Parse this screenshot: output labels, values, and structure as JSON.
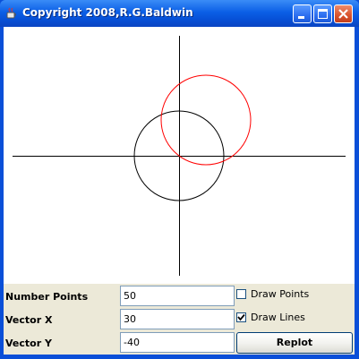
{
  "window": {
    "title": "Copyright 2008,R.G.Baldwin",
    "buttons": [
      "minimize",
      "maximize",
      "close"
    ]
  },
  "canvas": {
    "axis_color": "#000000",
    "base_circle_color": "#000000",
    "shifted_circle_color": "#ff0000"
  },
  "controls": {
    "number_points": {
      "label": "Number Points",
      "value": "50"
    },
    "vector_x": {
      "label": "Vector X",
      "value": "30"
    },
    "vector_y": {
      "label": "Vector Y",
      "value": "-40"
    },
    "draw_points": {
      "label": "Draw Points",
      "checked": false
    },
    "draw_lines": {
      "label": "Draw Lines",
      "checked": true
    },
    "replot_label": "Replot"
  },
  "colors": {
    "titlebar": "#0b5fe6",
    "panel": "#ece9d8",
    "close_button": "#d9532d"
  }
}
